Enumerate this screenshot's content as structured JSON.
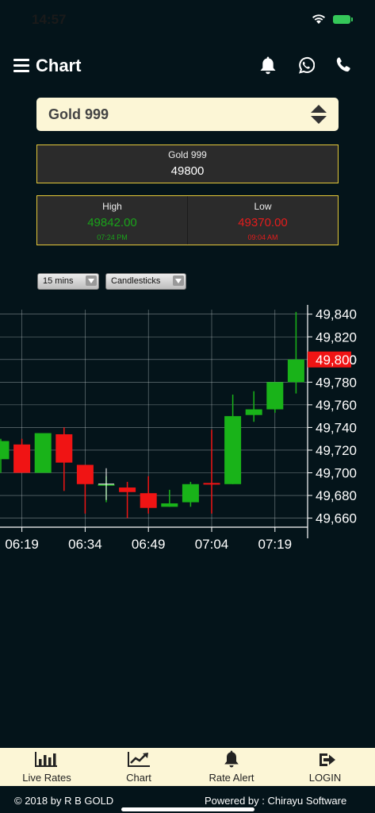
{
  "status": {
    "time": "14:57"
  },
  "appbar": {
    "title": "Chart"
  },
  "selector": {
    "value": "Gold 999"
  },
  "price": {
    "name": "Gold 999",
    "value": "49800"
  },
  "high": {
    "label": "High",
    "value": "49842.00",
    "time": "07:24 PM",
    "color": "#1aa31a"
  },
  "low": {
    "label": "Low",
    "value": "49370.00",
    "time": "09:04 AM",
    "color": "#e61c1c"
  },
  "controls": {
    "interval": "15 mins",
    "style": "Candlesticks"
  },
  "chart_data": {
    "type": "candlestick",
    "x_ticks": [
      "06:19",
      "06:34",
      "06:49",
      "07:04",
      "07:19"
    ],
    "y_ticks": [
      "49,840",
      "49,820",
      "49,800",
      "49,780",
      "49,760",
      "49,740",
      "49,720",
      "49,700",
      "49,680",
      "49,660"
    ],
    "ylim": [
      49652,
      49844
    ],
    "current_price_label": "49,800",
    "current_price": 49800,
    "up_color": "#19b319",
    "down_color": "#f01414",
    "candles": [
      {
        "x": 0,
        "open": 49712,
        "high": 49730,
        "low": 49700,
        "close": 49728
      },
      {
        "x": 1,
        "open": 49725,
        "high": 49730,
        "low": 49700,
        "close": 49700
      },
      {
        "x": 2,
        "open": 49700,
        "high": 49730,
        "low": 49700,
        "close": 49735
      },
      {
        "x": 3,
        "open": 49734,
        "high": 49740,
        "low": 49684,
        "close": 49709
      },
      {
        "x": 4,
        "open": 49707,
        "high": 49707,
        "low": 49664,
        "close": 49690
      },
      {
        "x": 5,
        "open": 49690,
        "high": 49697,
        "low": 49674,
        "close": 49690
      },
      {
        "x": 6,
        "open": 49687,
        "high": 49692,
        "low": 49660,
        "close": 49683
      },
      {
        "x": 7,
        "open": 49682,
        "high": 49697,
        "low": 49664,
        "close": 49669
      },
      {
        "x": 8,
        "open": 49670,
        "high": 49685,
        "low": 49670,
        "close": 49673
      },
      {
        "x": 9,
        "open": 49674,
        "high": 49692,
        "low": 49670,
        "close": 49690
      },
      {
        "x": 10,
        "open": 49691,
        "high": 49738,
        "low": 49664,
        "close": 49690
      },
      {
        "x": 11,
        "open": 49690,
        "high": 49769,
        "low": 49690,
        "close": 49750
      },
      {
        "x": 12,
        "open": 49751,
        "high": 49772,
        "low": 49745,
        "close": 49756
      },
      {
        "x": 13,
        "open": 49756,
        "high": 49780,
        "low": 49753,
        "close": 49780
      },
      {
        "x": 14,
        "open": 49780,
        "high": 49842,
        "low": 49770,
        "close": 49800
      }
    ]
  },
  "tabs": [
    {
      "label": "Live Rates",
      "icon": "bar-chart-icon"
    },
    {
      "label": "Chart",
      "icon": "line-chart-icon"
    },
    {
      "label": "Rate Alert",
      "icon": "bell-icon"
    },
    {
      "label": "LOGIN",
      "icon": "sign-in-icon"
    }
  ],
  "footer": {
    "copyright": "© 2018 by R B GOLD",
    "powered": "Powered by : Chirayu Software"
  }
}
